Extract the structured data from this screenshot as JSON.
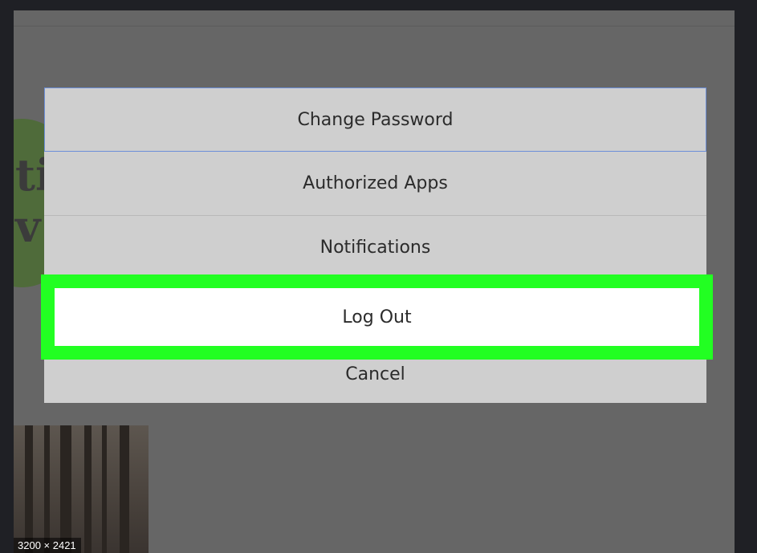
{
  "background": {
    "logo_text": "ti\nv",
    "thumbnail_label": "3200 × 2421"
  },
  "action_sheet": {
    "items": [
      {
        "label": "Change Password"
      },
      {
        "label": "Authorized Apps"
      },
      {
        "label": "Notifications"
      },
      {
        "label": "Log Out"
      },
      {
        "label": "Cancel"
      }
    ]
  },
  "colors": {
    "highlight": "#22ff22",
    "overlay": "#666666",
    "sheet_item": "#cfcfcf",
    "focus_border": "#6c8fd8"
  }
}
